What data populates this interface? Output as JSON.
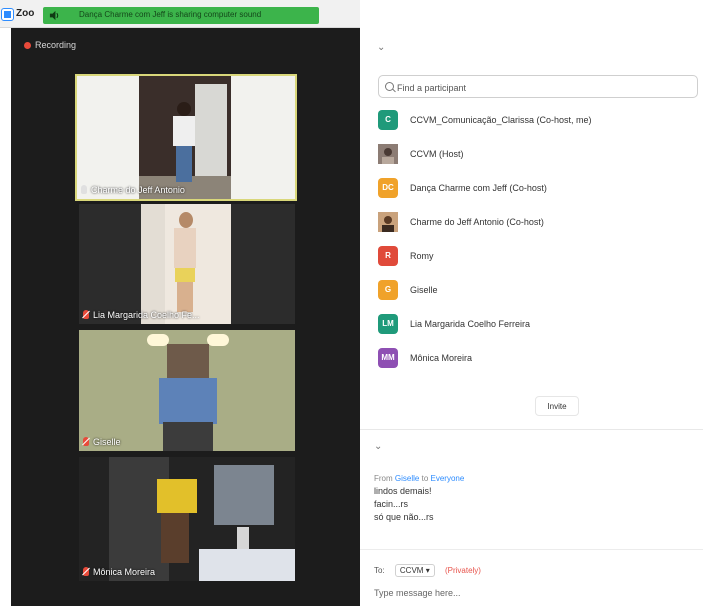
{
  "window": {
    "app_title": "Zoo",
    "share_banner": "Dança Charme com Jeff is sharing computer sound"
  },
  "video": {
    "recording_label": "Recording",
    "tiles": [
      {
        "name": "Charme do Jeff Antonio",
        "active": true,
        "mic": "on"
      },
      {
        "name": "Lia Margarida Coelho Fe...",
        "active": false,
        "mic": "muted"
      },
      {
        "name": "Giselle",
        "active": false,
        "mic": "muted"
      },
      {
        "name": "Mônica Moreira",
        "active": false,
        "mic": "muted"
      }
    ]
  },
  "participants": {
    "search_placeholder": "Find a participant",
    "items": [
      {
        "initials": "C",
        "color": "#1f9a7a",
        "name": "CCVM_Comunicação_Clarissa (Co-host, me)"
      },
      {
        "initials": "",
        "color": "#7a6a62",
        "name": "CCVM (Host)",
        "photo": true
      },
      {
        "initials": "DC",
        "color": "#f0a22a",
        "name": "Dança Charme com Jeff (Co-host)"
      },
      {
        "initials": "",
        "color": "#8a5a3a",
        "name": "Charme do Jeff Antonio (Co-host)",
        "photo": true
      },
      {
        "initials": "R",
        "color": "#e04a3a",
        "name": "Romy"
      },
      {
        "initials": "G",
        "color": "#f0a22a",
        "name": "Giselle"
      },
      {
        "initials": "LM",
        "color": "#1f9a7a",
        "name": "Lia Margarida Coelho Ferreira"
      },
      {
        "initials": "MM",
        "color": "#8e4fb3",
        "name": "Mônica Moreira"
      }
    ],
    "invite_label": "Invite"
  },
  "chat": {
    "from_prefix": "From",
    "from_name": "Giselle",
    "to_word": "to",
    "to_name": "Everyone",
    "messages": [
      "lindos demais!",
      "facin...rs",
      "só que não...rs"
    ],
    "to_label": "To:",
    "recipient": "CCVM",
    "privately": "(Privately)",
    "input_placeholder": "Type message here..."
  }
}
